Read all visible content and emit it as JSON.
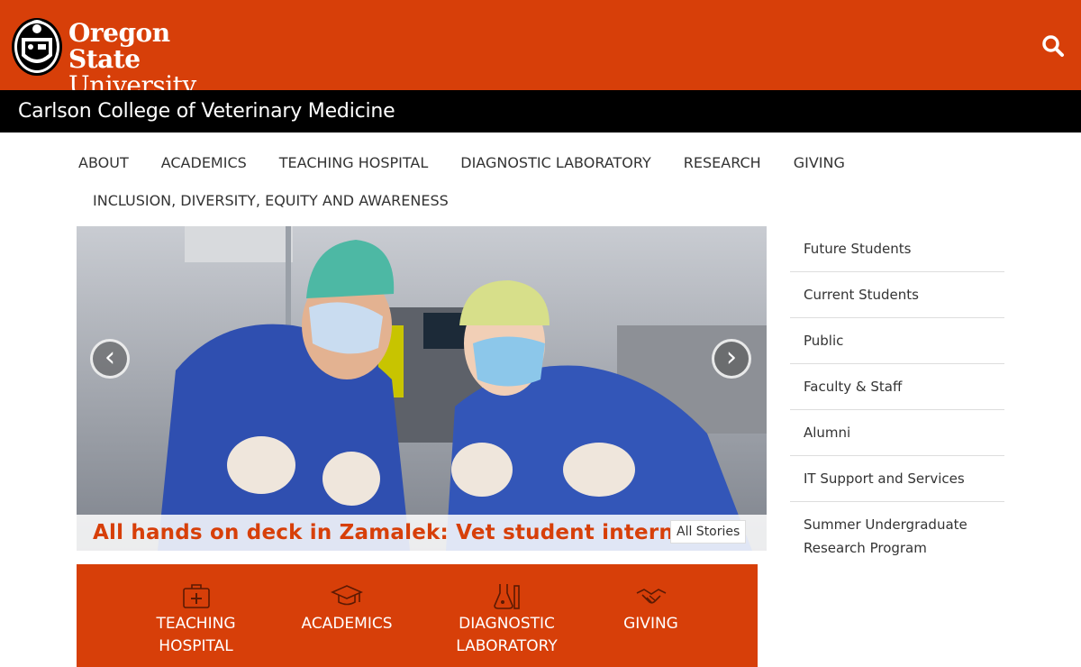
{
  "brand": {
    "university_line1": "Oregon State",
    "university_line2": "University",
    "college_name": "Carlson College of Veterinary Medicine",
    "colors": {
      "orange": "#d73f09",
      "black": "#000000",
      "white": "#ffffff"
    }
  },
  "header": {
    "search_icon": "search-icon"
  },
  "main_nav": {
    "items": [
      {
        "label": "ABOUT"
      },
      {
        "label": "ACADEMICS"
      },
      {
        "label": "TEACHING HOSPITAL"
      },
      {
        "label": "DIAGNOSTIC LABORATORY"
      },
      {
        "label": "RESEARCH"
      },
      {
        "label": "GIVING"
      },
      {
        "label": "INCLUSION, DIVERSITY, EQUITY AND AWARENESS"
      }
    ]
  },
  "hero": {
    "prev_label": "‹",
    "next_label": "›",
    "caption_title": "All hands on deck in Zamalek: Vet student interns in",
    "all_stories_label": "All Stories"
  },
  "sidebar": {
    "items": [
      {
        "label": "Future Students"
      },
      {
        "label": "Current Students"
      },
      {
        "label": "Public"
      },
      {
        "label": "Faculty & Staff"
      },
      {
        "label": "Alumni"
      },
      {
        "label": "IT Support and Services"
      },
      {
        "label": "Summer Undergraduate Research Program"
      }
    ]
  },
  "quick_links": {
    "items": [
      {
        "line1": "TEACHING",
        "line2": "HOSPITAL",
        "icon": "medical-kit-icon"
      },
      {
        "line1": "ACADEMICS",
        "line2": "",
        "icon": "graduation-cap-icon"
      },
      {
        "line1": "DIAGNOSTIC",
        "line2": "LABORATORY",
        "icon": "lab-flask-icon"
      },
      {
        "line1": "GIVING",
        "line2": "",
        "icon": "handshake-icon"
      }
    ]
  }
}
